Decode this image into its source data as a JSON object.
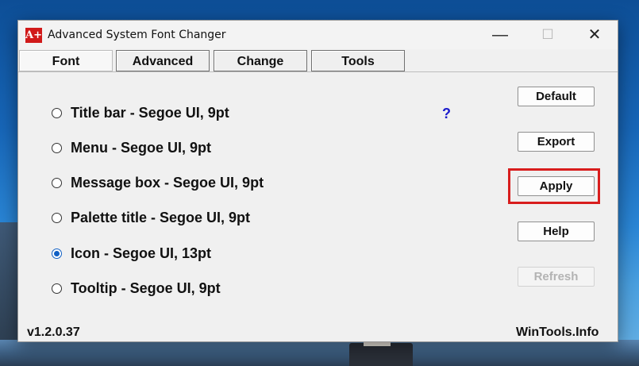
{
  "window": {
    "title": "Advanced System Font Changer",
    "app_icon": "A+"
  },
  "window_controls": {
    "minimize": "—",
    "maximize": "☐",
    "close": "✕"
  },
  "tabs": [
    {
      "label": "Font",
      "active": true
    },
    {
      "label": "Advanced",
      "active": false
    },
    {
      "label": "Change",
      "active": false
    },
    {
      "label": "Tools",
      "active": false
    }
  ],
  "font_options": [
    {
      "label": "Title bar - Segoe UI, 9pt",
      "selected": false
    },
    {
      "label": "Menu - Segoe UI, 9pt",
      "selected": false
    },
    {
      "label": "Message box - Segoe UI, 9pt",
      "selected": false
    },
    {
      "label": "Palette title - Segoe UI, 9pt",
      "selected": false
    },
    {
      "label": "Icon - Segoe UI, 13pt",
      "selected": true
    },
    {
      "label": "Tooltip - Segoe UI, 9pt",
      "selected": false
    }
  ],
  "help_mark": "?",
  "buttons": {
    "default": "Default",
    "export": "Export",
    "apply": "Apply",
    "help": "Help",
    "refresh": "Refresh"
  },
  "footer": {
    "version": "v1.2.0.37",
    "site": "WinTools.Info"
  },
  "colors": {
    "highlight": "#d81d1d",
    "link_blue": "#1a1acc",
    "radio_accent": "#1160c4"
  }
}
